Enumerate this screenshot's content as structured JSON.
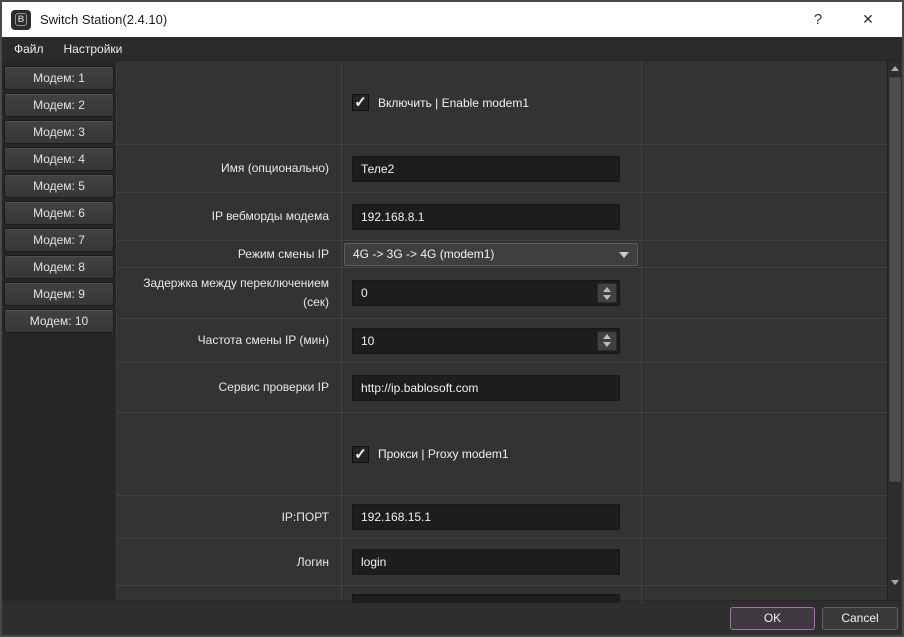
{
  "window": {
    "title": "Switch Station(2.4.10)",
    "icon_letter": "B",
    "help_glyph": "?",
    "close_glyph": "✕"
  },
  "menu": {
    "items": [
      "Файл",
      "Настройки"
    ]
  },
  "sidebar": {
    "items": [
      "Модем: 1",
      "Модем: 2",
      "Модем: 3",
      "Модем: 4",
      "Модем: 5",
      "Модем: 6",
      "Модем: 7",
      "Модем: 8",
      "Модем: 9",
      "Модем: 10"
    ]
  },
  "form": {
    "enable_checkbox": {
      "label": "Включить | Enable modem1",
      "checked": true
    },
    "name_row": {
      "label": "Имя (опционально)",
      "value": "Теле2"
    },
    "webip_row": {
      "label": "IP вебморды модема",
      "value": "192.168.8.1"
    },
    "mode_row": {
      "label": "Режим смены IP",
      "value": "4G -> 3G -> 4G (modem1)"
    },
    "delay_row": {
      "label": "Задержка между переключением (сек)",
      "value": "0"
    },
    "freq_row": {
      "label": "Частота смены IP (мин)",
      "value": "10"
    },
    "service_row": {
      "label": "Сервис проверки IP",
      "value": "http://ip.bablosoft.com"
    },
    "proxy_checkbox": {
      "label": "Прокси | Proxy modem1",
      "checked": true
    },
    "ipport_row": {
      "label": "IP:ПОРТ",
      "value": "192.168.15.1"
    },
    "login_row": {
      "label": "Логин",
      "value": "login"
    }
  },
  "icons": {
    "check": "✓"
  },
  "footer": {
    "ok": "OK",
    "cancel": "Cancel"
  },
  "colors": {
    "accent_purple": "#a173a6",
    "titlebar_bg": "#ffffff",
    "panel_bg": "#333333",
    "input_bg": "#1d1d1d"
  }
}
